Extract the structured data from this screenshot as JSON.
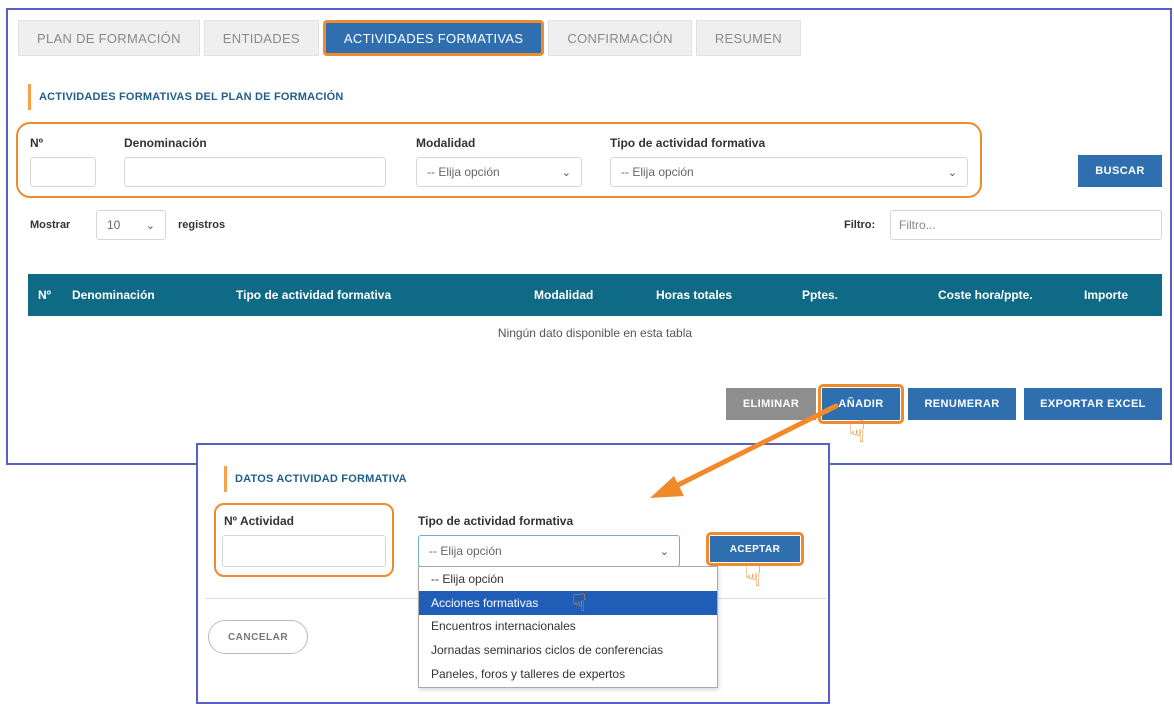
{
  "tabs": [
    {
      "label": "PLAN DE FORMACIÓN"
    },
    {
      "label": "ENTIDADES"
    },
    {
      "label": "ACTIVIDADES FORMATIVAS"
    },
    {
      "label": "CONFIRMACIÓN"
    },
    {
      "label": "RESUMEN"
    }
  ],
  "section_title": "ACTIVIDADES FORMATIVAS DEL PLAN DE FORMACIÓN",
  "filters": {
    "num_label": "Nº",
    "num_value": "",
    "denominacion_label": "Denominación",
    "denominacion_value": "",
    "modalidad_label": "Modalidad",
    "modalidad_value": "-- Elija opción",
    "tipo_label": "Tipo de actividad formativa",
    "tipo_value": "-- Elija opción",
    "search_button": "BUSCAR"
  },
  "table_controls": {
    "show_label": "Mostrar",
    "show_value": "10",
    "records_label": "registros",
    "filter_label": "Filtro:",
    "filter_placeholder": "Filtro..."
  },
  "table": {
    "columns": [
      "Nº",
      "Denominación",
      "Tipo de actividad formativa",
      "Modalidad",
      "Horas totales",
      "Pptes.",
      "Coste hora/ppte.",
      "Importe"
    ],
    "empty_message": "Ningún dato disponible en esta tabla"
  },
  "actions": {
    "delete": "ELIMINAR",
    "add": "AÑADIR",
    "renumber": "RENUMERAR",
    "export": "EXPORTAR EXCEL"
  },
  "modal": {
    "title": "DATOS ACTIVIDAD FORMATIVA",
    "num_label": "Nº Actividad",
    "num_value": "",
    "tipo_label": "Tipo de actividad formativa",
    "tipo_value": "-- Elija opción",
    "accept_button": "ACEPTAR",
    "cancel_button": "CANCELAR",
    "dropdown_options": [
      "-- Elija opción",
      "Acciones formativas",
      "Encuentros internacionales",
      "Jornadas seminarios ciclos de conferencias",
      "Paneles, foros y talleres de expertos"
    ],
    "selected_option": "Acciones formativas"
  },
  "colors": {
    "accent_orange": "#f08a2c",
    "primary_blue": "#2f6fb0",
    "table_header": "#0f6a85",
    "frame_border": "#5a5fc8"
  }
}
